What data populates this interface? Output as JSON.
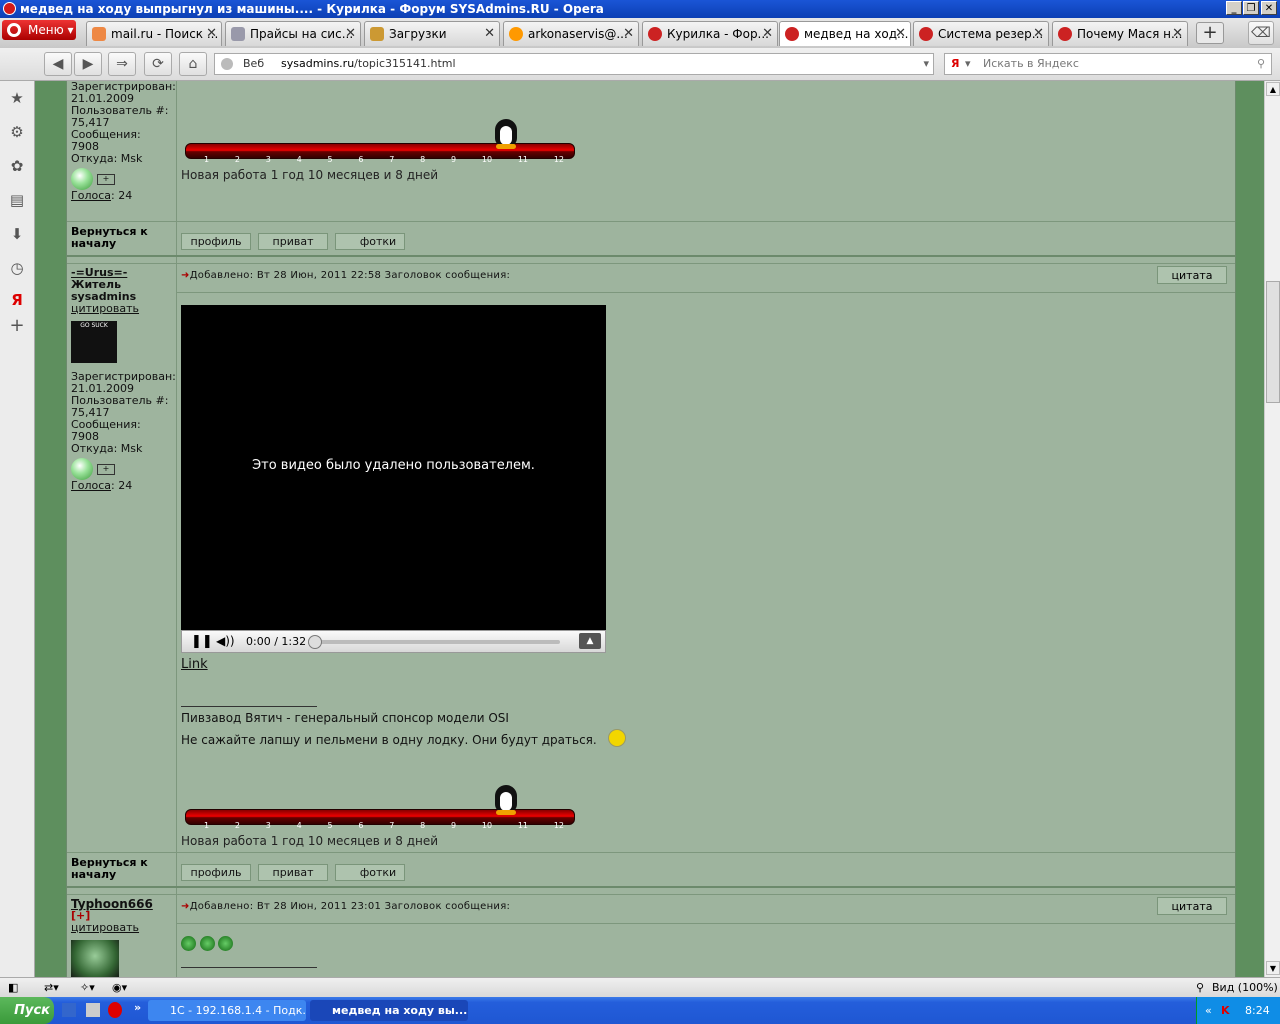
{
  "window": {
    "title": "медвед на ходу выпрыгнул из машины.... - Курилка - Форум SYSAdmins.RU - Opera",
    "controls": [
      "_",
      "❐",
      "✕"
    ]
  },
  "browser": {
    "menu_label": "Меню",
    "tabs": [
      {
        "label": "mail.ru - Поиск ...",
        "favicon_color": "#e84",
        "active": false
      },
      {
        "label": "Прайсы на сис...",
        "favicon_color": "#88a",
        "active": false
      },
      {
        "label": "Загрузки",
        "favicon_color": "#c93",
        "active": false
      },
      {
        "label": "arkonaservis@...",
        "favicon_color": "#f90",
        "active": false
      },
      {
        "label": "Курилка - Фор...",
        "favicon_color": "#c22",
        "active": false
      },
      {
        "label": "медвед на ход...",
        "favicon_color": "#c22",
        "active": true
      },
      {
        "label": "Система резер...",
        "favicon_color": "#c22",
        "active": false
      },
      {
        "label": "Почему Мася н...",
        "favicon_color": "#c22",
        "active": false
      }
    ],
    "address": {
      "mode_label": "Веб",
      "domain": "sysadmins.ru",
      "path": "/topic315141.html"
    },
    "search": {
      "engine_icon": "Я",
      "placeholder": "Искать в Яндекс"
    },
    "zoom_label": "Вид (100%)"
  },
  "posts": [
    {
      "registered_label": "Зарегистрирован:",
      "registered": "21.01.2009",
      "user_num_label": "Пользователь #:",
      "user_num": "75,417",
      "messages_label": "Сообщения:",
      "messages": "7908",
      "from_label": "Откуда: Msk",
      "votes_label": "Голоса",
      "votes": ": 24",
      "work": "Новая работа 1 год 10 месяцев и 8 дней",
      "back_to_top": "Вернуться к началу",
      "buttons": [
        "профиль",
        "приват",
        "фотки"
      ]
    },
    {
      "username": "-=Urus=-",
      "rank": "Житель sysadmins",
      "cite_label": "цитировать",
      "avatar_text": "GO SUCK",
      "registered_label": "Зарегистрирован:",
      "registered": "21.01.2009",
      "user_num_label": "Пользователь #:",
      "user_num": "75,417",
      "messages_label": "Сообщения:",
      "messages": "7908",
      "from_label": "Откуда: Msk",
      "votes_label": "Голоса",
      "votes": ": 24",
      "header": "Добавлено: Вт 28 Июн, 2011 22:58    Заголовок сообщения:",
      "quote_label": "цитата",
      "video_message": "Это видео было удалено пользователем.",
      "video_time": "0:00 / 1:32",
      "link_label": "Link",
      "sig_line1": "Пивзавод Вятич - генеральный спонсор модели OSI",
      "sig_line2": "Не сажайте лапшу и пельмени в одну лодку. Они будут драться.",
      "work": "Новая работа 1 год 10 месяцев и 8 дней",
      "back_to_top": "Вернуться к началу",
      "buttons": [
        "профиль",
        "приват",
        "фотки"
      ]
    },
    {
      "username": "Typhoon666",
      "badge": "[+]",
      "cite_label": "цитировать",
      "header": "Добавлено: Вт 28 Июн, 2011 23:01    Заголовок сообщения:",
      "quote_label": "цитата"
    }
  ],
  "progress": {
    "ticks": [
      "1",
      "2",
      "3",
      "4",
      "5",
      "6",
      "7",
      "8",
      "9",
      "10",
      "11",
      "12"
    ],
    "penguin_position": 10.6
  },
  "taskbar": {
    "start_label": "Пуск",
    "tasks": [
      {
        "label": "1С - 192.168.1.4 - Подк...",
        "active": false
      },
      {
        "label": "медвед на ходу вы...",
        "active": true
      }
    ],
    "clock": "8:24"
  }
}
